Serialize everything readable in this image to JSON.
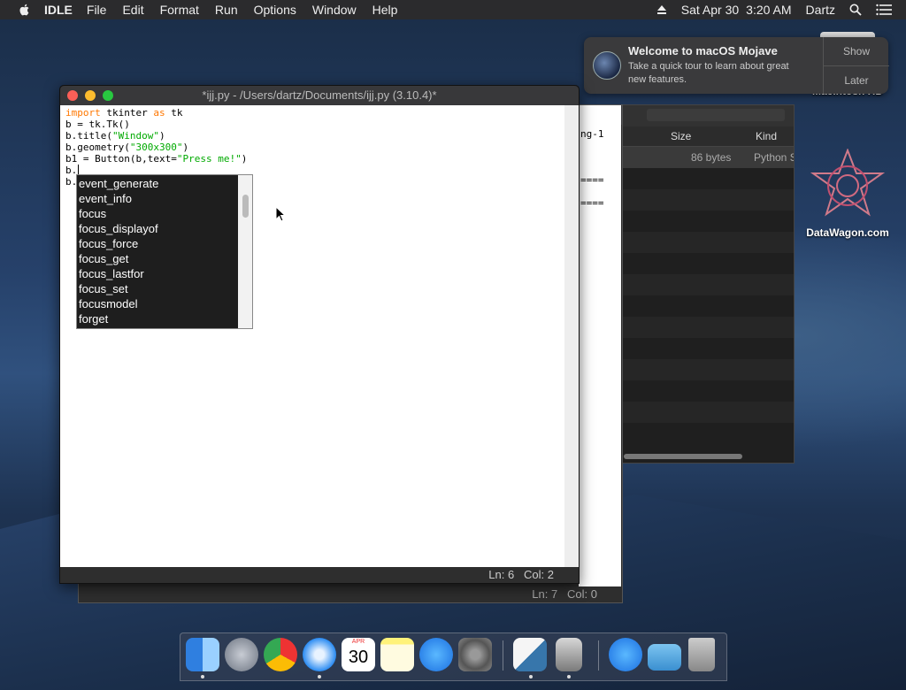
{
  "menubar": {
    "app": "IDLE",
    "items": [
      "File",
      "Edit",
      "Format",
      "Run",
      "Options",
      "Window",
      "Help"
    ],
    "date": "Sat Apr 30",
    "time": "3:20 AM",
    "user": "Dartz"
  },
  "notification": {
    "title": "Welcome to macOS Mojave",
    "body": "Take a quick tour to learn about great new features.",
    "show": "Show",
    "later": "Later"
  },
  "desktop": {
    "hd_label": "Macintosh HD",
    "site_label": "DataWagon.com"
  },
  "finder": {
    "col_size": "Size",
    "col_kind": "Kind",
    "row_size": "86 bytes",
    "row_kind": "Python S"
  },
  "shell": {
    "snippet": "ng-1",
    "sep1": "====",
    "sep2": "====",
    "status": "Ln: 7   Col: 0"
  },
  "editor": {
    "title": "*ijj.py - /Users/dartz/Documents/ijj.py (3.10.4)*",
    "status": "Ln: 6   Col: 2",
    "code": {
      "l1_kw1": "import",
      "l1_mid": " tkinter ",
      "l1_kw2": "as",
      "l1_end": " tk",
      "l2": "b = tk.Tk()",
      "l3_a": "b.title(",
      "l3_s": "\"Window\"",
      "l3_b": ")",
      "l4_a": "b.geometry(",
      "l4_s": "\"300x300\"",
      "l4_b": ")",
      "l5_a": "b1 = Button(b,text=",
      "l5_s": "\"Press me!\"",
      "l5_b": ")",
      "l6": "b.",
      "l7": "b."
    }
  },
  "autocomplete": {
    "items": [
      "event_generate",
      "event_info",
      "focus",
      "focus_displayof",
      "focus_force",
      "focus_get",
      "focus_lastfor",
      "focus_set",
      "focusmodel",
      "forget"
    ]
  },
  "dock": {
    "calendar_month": "APR",
    "calendar_day": "30"
  }
}
